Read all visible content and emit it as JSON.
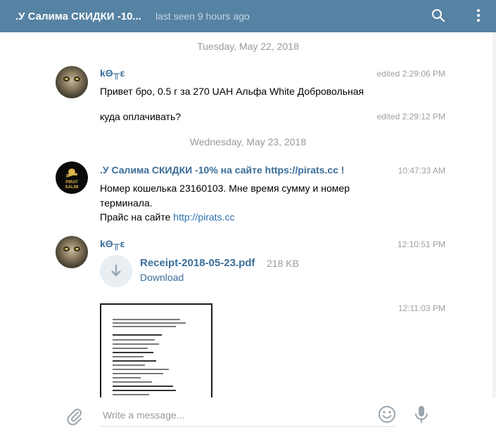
{
  "header": {
    "title": ".У Салима СКИДКИ -10...",
    "status": "last seen 9 hours ago",
    "search_icon": "search-icon",
    "menu_icon": "more-vertical-icon",
    "bg_color": "#5682a3"
  },
  "dates": [
    "Tuesday, May 22, 2018",
    "Wednesday, May 23, 2018"
  ],
  "messages": [
    {
      "author": "kΘ╥ε",
      "time": "edited 2:29:06 PM",
      "text": "Привет бро, 0.5 г за 270 UAH Альфа White Добровольная"
    },
    {
      "time": "edited 2:29:12 PM",
      "text": "куда оплачивать?"
    },
    {
      "author": ".У Салима СКИДКИ -10% на сайте https://pirats.cc !",
      "time": "10:47:33 AM",
      "line1": "Номер кошелька 23160103. Мне время  сумму и номер",
      "line2": "терминала.",
      "line3_prefix": "Прайс на сайте ",
      "link": "http://pirats.cc"
    },
    {
      "author": "kΘ╥ε",
      "time": "12:10:51 PM",
      "file_name": "Receipt-2018-05-23.pdf",
      "file_size": "218 KB",
      "file_action": "Download"
    },
    {
      "time": "12:11:03 PM",
      "attachment": "photo"
    }
  ],
  "avatar_pirat_text": [
    "PIRAT",
    "SALIM"
  ],
  "composer": {
    "placeholder": "Write a message...",
    "attach_icon": "paperclip-icon",
    "emoji_icon": "smile-icon",
    "mic_icon": "microphone-icon"
  }
}
